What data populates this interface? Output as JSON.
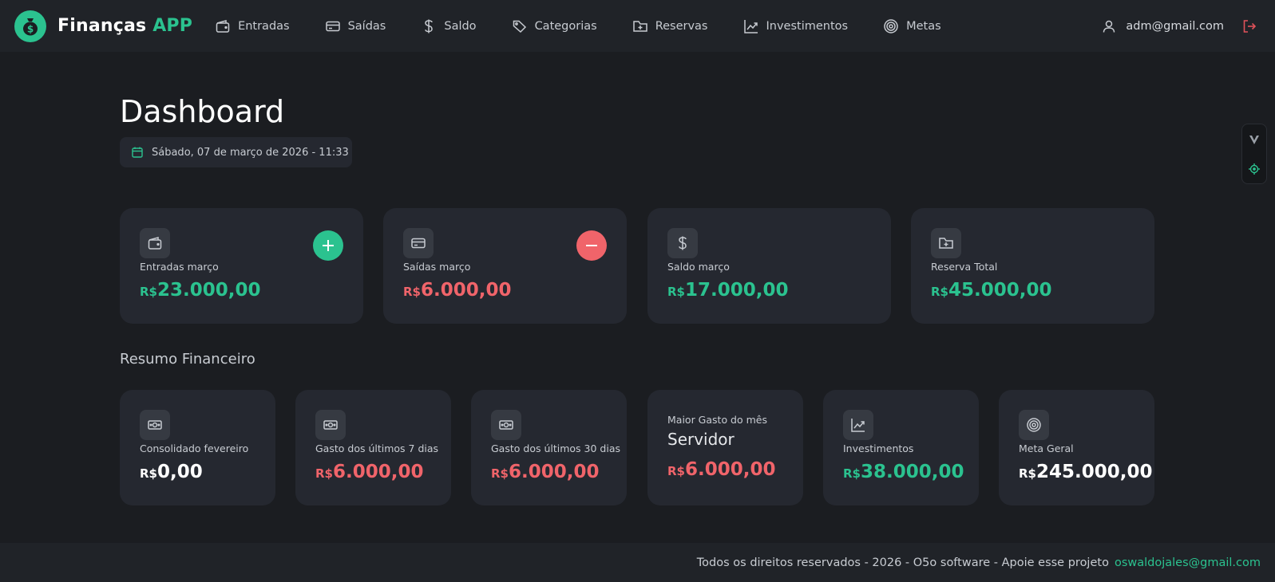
{
  "brand": {
    "name_main": "Finanças",
    "name_accent": "APP",
    "logo_icon": "money-bag-icon"
  },
  "nav": {
    "items": [
      {
        "label": "Entradas",
        "icon": "wallet-icon"
      },
      {
        "label": "Saídas",
        "icon": "credit-card-icon"
      },
      {
        "label": "Saldo",
        "icon": "dollar-icon"
      },
      {
        "label": "Categorias",
        "icon": "tags-icon"
      },
      {
        "label": "Reservas",
        "icon": "folder-plus-icon"
      },
      {
        "label": "Investimentos",
        "icon": "chart-line-icon"
      },
      {
        "label": "Metas",
        "icon": "target-icon"
      }
    ]
  },
  "user": {
    "email": "adm@gmail.com"
  },
  "page": {
    "title": "Dashboard",
    "datetime": "Sábado, 07 de março de 2026 - 11:33"
  },
  "summary_cards": [
    {
      "label": "Entradas março",
      "currency": "R$",
      "amount": "23.000,00",
      "color": "#2bc28f",
      "icon": "wallet-icon",
      "action": "add"
    },
    {
      "label": "Saídas março",
      "currency": "R$",
      "amount": "6.000,00",
      "color": "#f0646a",
      "icon": "credit-card-icon",
      "action": "remove"
    },
    {
      "label": "Saldo março",
      "currency": "R$",
      "amount": "17.000,00",
      "color": "#2bc28f",
      "icon": "dollar-icon"
    },
    {
      "label": "Reserva Total",
      "currency": "R$",
      "amount": "45.000,00",
      "color": "#2bc28f",
      "icon": "folder-plus-icon"
    }
  ],
  "financial_summary": {
    "title": "Resumo Financeiro",
    "cards": [
      {
        "label": "Consolidado fevereiro",
        "currency": "R$",
        "amount": "0,00",
        "icon": "banknote-icon"
      },
      {
        "label": "Gasto dos últimos 7 dias",
        "currency": "R$",
        "amount": "6.000,00",
        "icon": "banknote-icon"
      },
      {
        "label": "Gasto dos últimos 30 dias",
        "currency": "R$",
        "amount": "6.000,00",
        "icon": "banknote-icon"
      },
      {
        "label": "Maior Gasto do mês",
        "name": "Servidor",
        "currency": "R$",
        "amount": "6.000,00"
      },
      {
        "label": "Investimentos",
        "currency": "R$",
        "amount": "38.000,00",
        "icon": "chart-line-icon"
      },
      {
        "label": "Meta Geral",
        "currency": "R$",
        "amount": "245.000,00",
        "icon": "target-icon"
      }
    ]
  },
  "footer": {
    "text": "Todos os direitos reservados - 2026 - O5o software - Apoie esse projeto",
    "email": "oswaldojales@gmail.com"
  },
  "colors": {
    "accent": "#2bc28f",
    "danger": "#f0646a",
    "background": "#1b1d21",
    "card": "#252830"
  }
}
